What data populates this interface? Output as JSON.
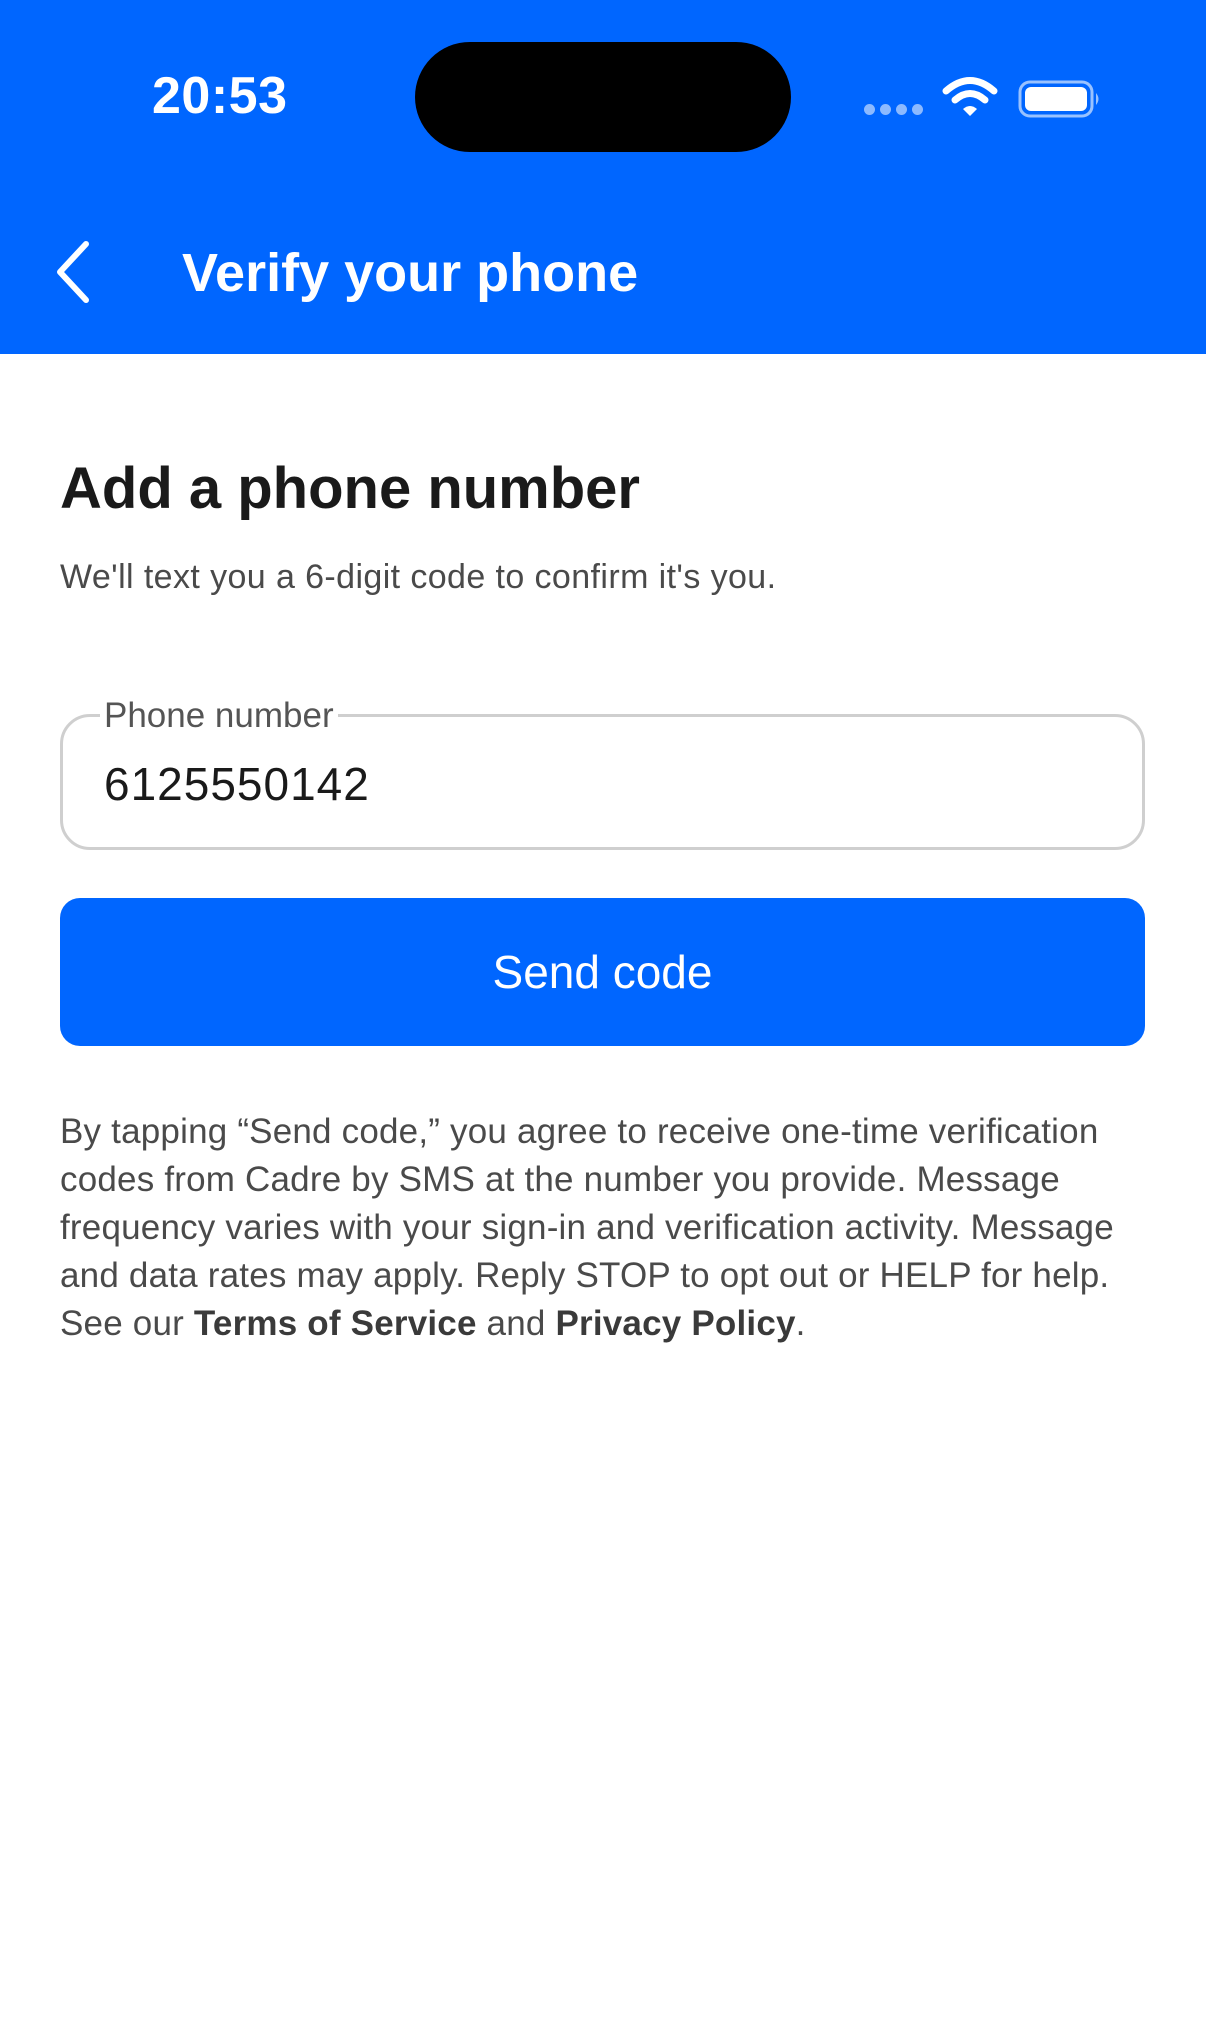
{
  "status_bar": {
    "time": "20:53"
  },
  "nav": {
    "title": "Verify your phone",
    "back_icon": "chevron-left-icon"
  },
  "content": {
    "title": "Add a phone number",
    "subtitle": "We'll text you a 6-digit code to confirm it's you.",
    "phone_field": {
      "label": "Phone number",
      "value": "6125550142"
    },
    "send_button_label": "Send code",
    "disclaimer": {
      "text_before": "By tapping “Send code,” you agree to receive one-time verification codes from Cadre by SMS at the number you provide. Message frequency varies with your sign-in and verification activity. Message and data rates may apply. Reply STOP to opt out or HELP for help. See our ",
      "terms_link": "Terms of Service",
      "text_and": " and ",
      "privacy_link": "Privacy Policy",
      "text_after": "."
    }
  },
  "colors": {
    "primary": "#0066ff",
    "background": "#ffffff",
    "text": "#1a1a1a",
    "muted_text": "#4a4a4a",
    "field_border": "#cfcfcf"
  }
}
